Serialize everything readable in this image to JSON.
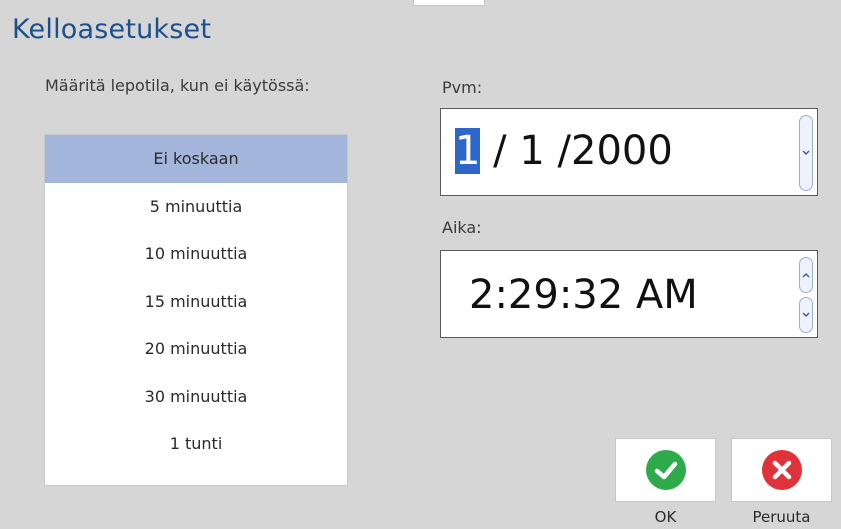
{
  "dialog": {
    "title": "Kelloasetukset",
    "sleep_label": "Määritä lepotila, kun ei käytössä:"
  },
  "sleep_options": [
    {
      "label": "Ei koskaan",
      "selected": true
    },
    {
      "label": "5 minuuttia",
      "selected": false
    },
    {
      "label": "10 minuuttia",
      "selected": false
    },
    {
      "label": "15 minuuttia",
      "selected": false
    },
    {
      "label": "20 minuuttia",
      "selected": false
    },
    {
      "label": "30 minuuttia",
      "selected": false
    },
    {
      "label": "1 tunti",
      "selected": false
    }
  ],
  "date": {
    "label": "Pvm:",
    "day": "1",
    "rest": " / 1 /2000"
  },
  "time": {
    "label": "Aika:",
    "value": "2:29:32 AM"
  },
  "buttons": {
    "ok_label": "OK",
    "cancel_label": "Peruuta"
  },
  "colors": {
    "title": "#1d4f8c",
    "selection": "#a4b5dc",
    "ok": "#2eaa4a",
    "cancel": "#e0323a"
  },
  "icons": {
    "ok": "check-icon",
    "cancel": "x-icon",
    "spin_up": "chevron-up-icon",
    "spin_down": "chevron-down-icon"
  }
}
